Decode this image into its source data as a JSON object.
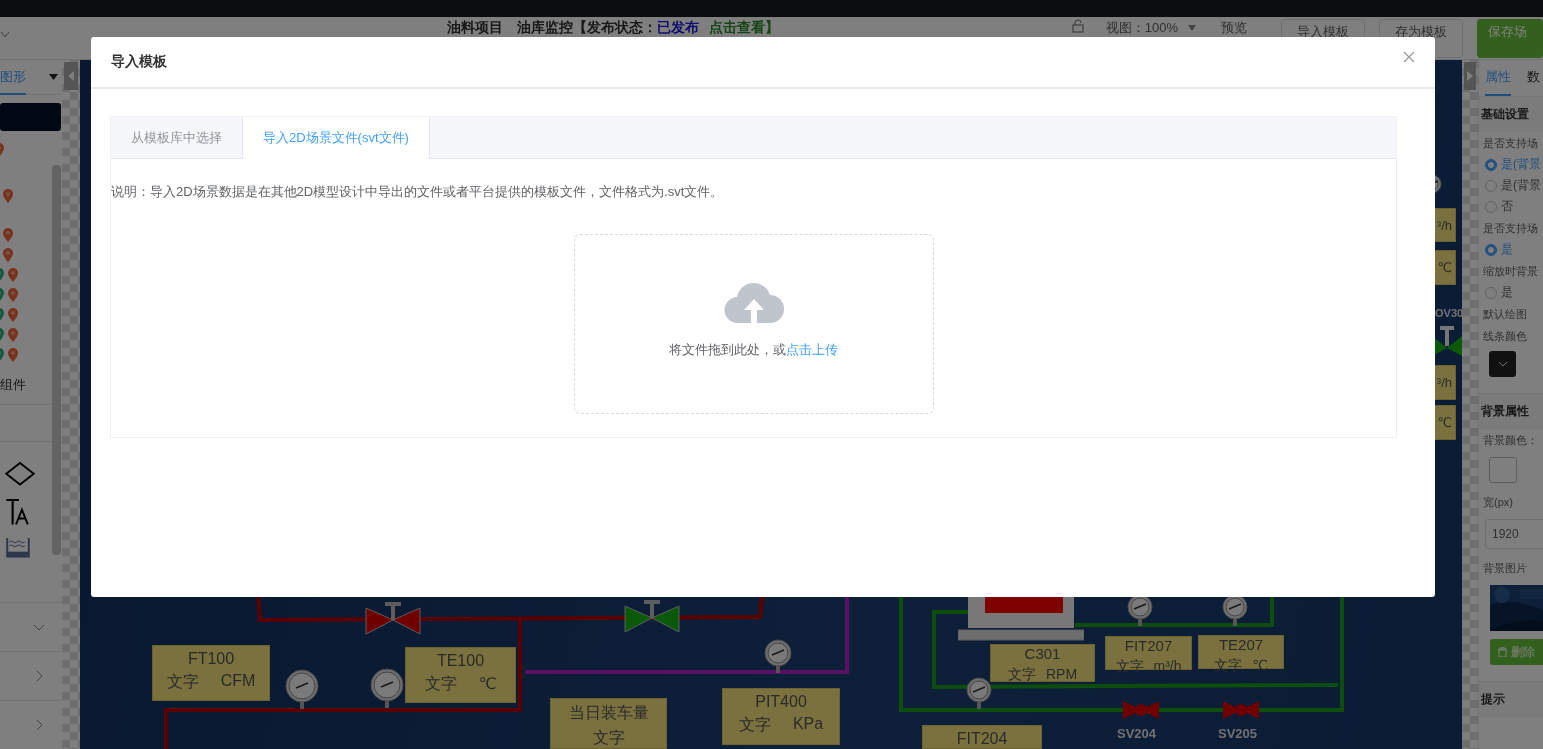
{
  "header": {
    "title": "油料项目",
    "status_label": "油库监控【发布状态：",
    "status": "已发布",
    "link": "点击查看】",
    "zoom": "视图：100%",
    "preview": "预览",
    "buttons": [
      {
        "label": "导入模板",
        "kind": "default"
      },
      {
        "label": "存为模板",
        "kind": "default"
      },
      {
        "label": "保存场",
        "kind": "primary"
      }
    ]
  },
  "left_panel": {
    "tab": "图形",
    "section": "组件",
    "accordions": [
      {
        "expanded": true
      },
      {
        "expanded": false
      },
      {
        "expanded": false
      }
    ]
  },
  "canvas": {
    "instruments": [
      {
        "title": "FT100",
        "text": "文字",
        "unit": "CFM"
      },
      {
        "title": "TE100",
        "text": "文字",
        "unit": "℃"
      },
      {
        "title": "当日装车量",
        "text": "文字"
      },
      {
        "title": "PIT400",
        "text": "文字",
        "unit": "KPa"
      },
      {
        "title": "C301",
        "text": "文字",
        "unit": "RPM"
      },
      {
        "title": "FIT207",
        "text": "文字",
        "unit": "m³/h"
      },
      {
        "title": "TE207",
        "text": "文字",
        "unit": "℃"
      },
      {
        "title": "FIT204"
      },
      {
        "unit": "³/h"
      },
      {
        "unit": "℃"
      },
      {
        "unit": "³/h"
      },
      {
        "unit": "℃"
      }
    ],
    "valve_labels": [
      "SV204",
      "SV205"
    ],
    "edge_label": "OV30"
  },
  "right_panel": {
    "tabs": [
      {
        "label": "属性",
        "selected": true
      },
      {
        "label": "数",
        "selected": false
      }
    ],
    "rows": [
      {
        "kind": "heading",
        "text": "基础设置"
      },
      {
        "kind": "label",
        "text": "是否支持场"
      },
      {
        "kind": "radio",
        "text": "是(背景",
        "selected": true
      },
      {
        "kind": "radio",
        "text": "是(背景",
        "selected": false
      },
      {
        "kind": "radio",
        "text": "否",
        "selected": false
      },
      {
        "kind": "label",
        "text": "是否支持场"
      },
      {
        "kind": "radio",
        "text": "是",
        "selected": true
      },
      {
        "kind": "label",
        "text": "缩放时背景"
      },
      {
        "kind": "radio",
        "text": "是",
        "selected": false
      },
      {
        "kind": "label",
        "text": "默认绘图"
      },
      {
        "kind": "label",
        "text": "线条颜色"
      },
      {
        "kind": "color-select"
      },
      {
        "kind": "heading",
        "text": "背景属性"
      },
      {
        "kind": "label",
        "text": "背景颜色："
      },
      {
        "kind": "swatch"
      },
      {
        "kind": "label",
        "text": "宽(px)"
      },
      {
        "kind": "input",
        "value": "1920"
      },
      {
        "kind": "label",
        "text": "背景图片"
      },
      {
        "kind": "picture"
      },
      {
        "kind": "button",
        "text": "删除"
      },
      {
        "kind": "heading",
        "text": "提示"
      }
    ]
  },
  "dialog": {
    "title": "导入模板",
    "tabs": [
      {
        "label": "从模板库中选择",
        "selected": false
      },
      {
        "label": "导入2D场景文件(svt文件)",
        "selected": true
      }
    ],
    "description": "说明：导入2D场景数据是在其他2D模型设计中导出的文件或者平台提供的模板文件，文件格式为.svt文件。",
    "upload": {
      "hint": "将文件拖到此处，或",
      "link": "点击上传"
    }
  }
}
